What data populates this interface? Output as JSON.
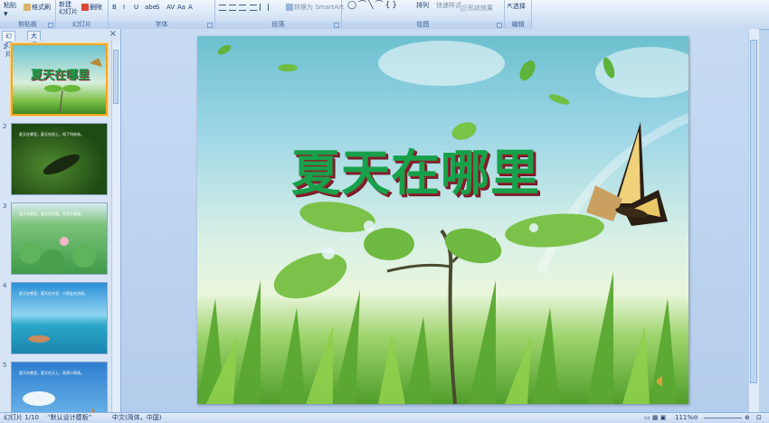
{
  "ribbon": {
    "groups": {
      "clipboard": {
        "label": "剪贴板",
        "paste": "粘贴",
        "format_painter": "格式刷"
      },
      "slides": {
        "label": "幻灯片",
        "new_slide": "新建\n幻灯片",
        "delete": "删除"
      },
      "font": {
        "label": "字体",
        "buttons": [
          "B",
          "I",
          "U",
          "abe",
          "S",
          "AV",
          "Aa",
          "A"
        ]
      },
      "paragraph": {
        "label": "段落",
        "smartart": "转换为 SmartArt"
      },
      "drawing": {
        "label": "绘图",
        "arrange": "排列",
        "quick_styles": "快速样式",
        "shape_effects": "形状效果"
      },
      "editing": {
        "label": "编辑",
        "select": "选择"
      }
    }
  },
  "left_pane": {
    "tabs": [
      "幻灯片",
      "大纲"
    ],
    "close": "×",
    "thumbnails": [
      {
        "num": "1",
        "caption": "夏天在哪里"
      },
      {
        "num": "2",
        "caption": "夏天在哪里，夏天在树上，知了叫吱吱。"
      },
      {
        "num": "3",
        "caption": "夏天在哪里，夏天在池塘，荷花开满塘。"
      },
      {
        "num": "4",
        "caption": "夏天在哪里，夏天在水里，小朋友在泡澡。"
      },
      {
        "num": "5",
        "caption": "夏天在哪里，夏天在天上，雨滴小雨滴。"
      }
    ]
  },
  "slide": {
    "title": "夏天在哪里"
  },
  "status": {
    "slide_pos": "幻灯片 1/10",
    "template": "“默认设计模板”",
    "language": "中文(简体，中国)",
    "zoom": "111%"
  },
  "colors": {
    "title_green": "#18a04b",
    "title_shadow": "#8b1f2a",
    "selection": "#f5a623"
  }
}
